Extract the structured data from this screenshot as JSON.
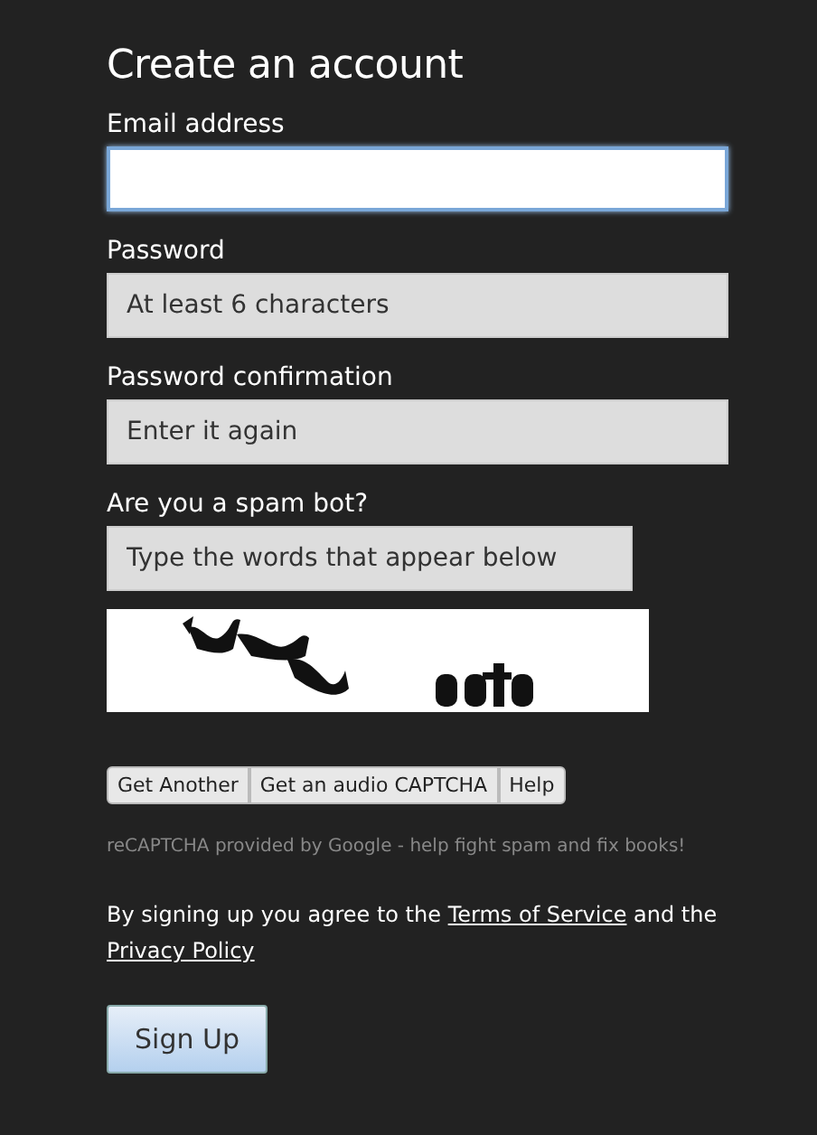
{
  "title": "Create an account",
  "fields": [
    {
      "label": "Email address",
      "focused": true
    },
    {
      "label": "Password",
      "placeholder": "At least 6 characters",
      "focused": false
    },
    {
      "label": "Password confirmation",
      "placeholder": "Enter it again",
      "focused": false
    }
  ],
  "captcha": {
    "label": "Are you a spam bot?",
    "placeholder": "Type the words that appear below",
    "buttons": [
      "Get Another",
      "Get an audio CAPTCHA",
      "Help"
    ],
    "credit": "reCAPTCHA provided by Google - help fight spam and fix books!"
  },
  "terms": {
    "before": "By signing up you agree to the",
    "terms_link": "Terms of Service",
    "middle": "and the",
    "privacy_link": "Privacy Policy"
  },
  "submit": "Sign Up"
}
